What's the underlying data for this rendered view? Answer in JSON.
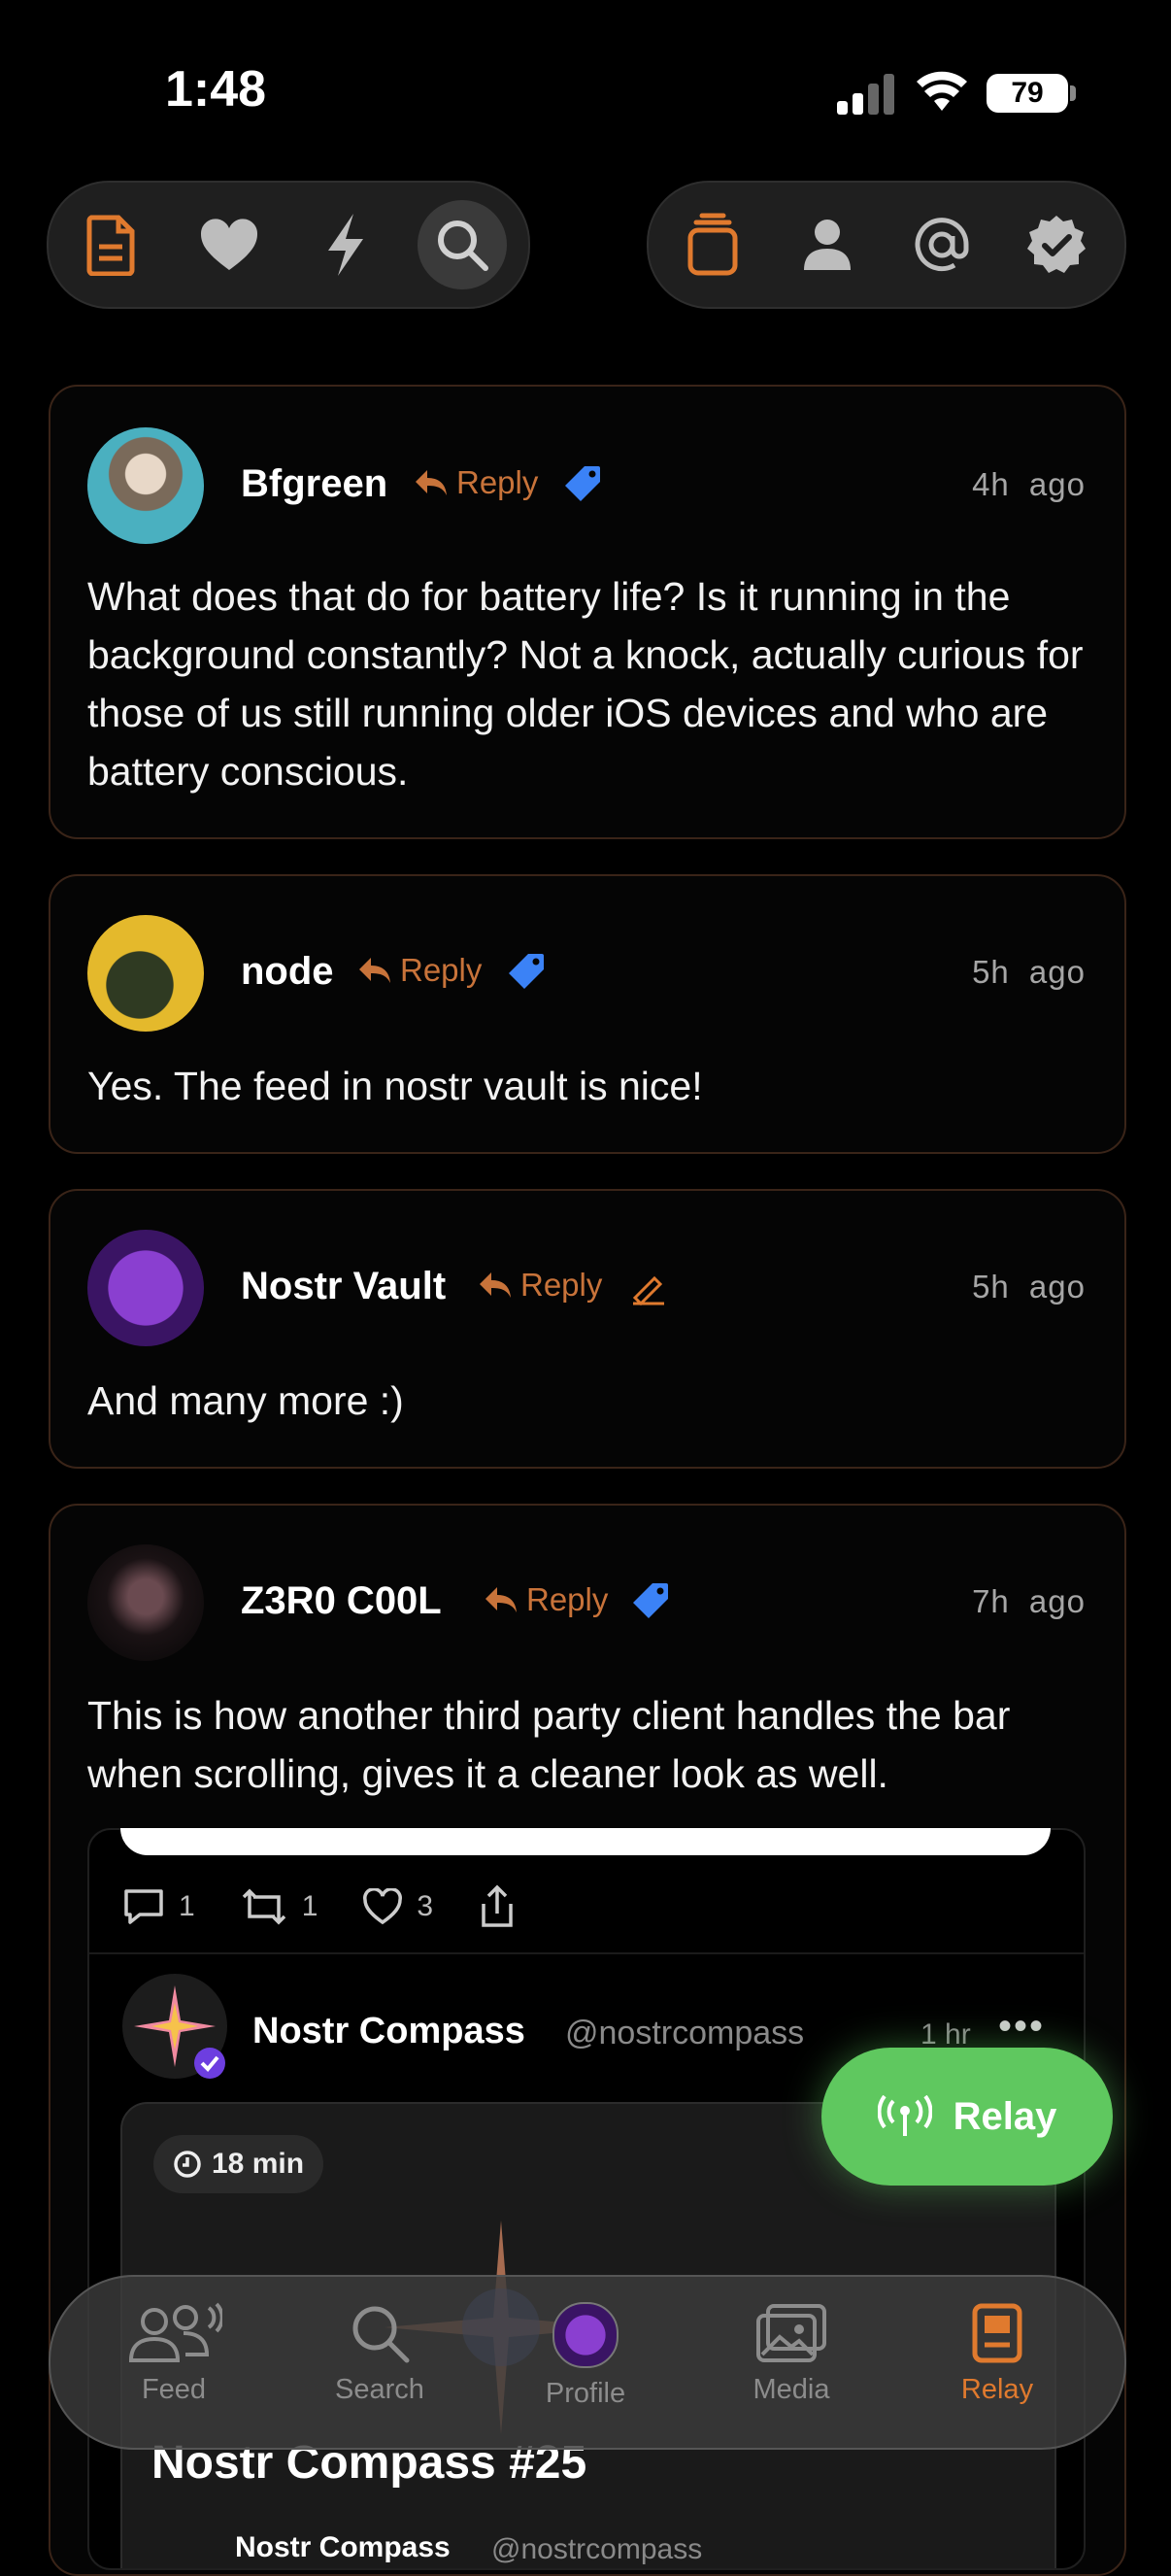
{
  "status_bar": {
    "time": "1:48",
    "battery": "79"
  },
  "top_nav": {
    "left_group": [
      "notes-icon",
      "heart-icon",
      "zap-icon",
      "search-icon"
    ],
    "right_group": [
      "stack-icon",
      "person-icon",
      "at-icon",
      "verified-icon"
    ],
    "accent": "#e07a2e"
  },
  "posts": [
    {
      "username": "Bfgreen",
      "reply_label": "Reply",
      "time": "4h ago",
      "badge": "blue-tag-icon",
      "text": "What does that do for battery life? Is it running in the background constantly? Not a knock, actually curious for those of us still running older iOS devices and who are battery conscious."
    },
    {
      "username": "node",
      "reply_label": "Reply",
      "time": "5h ago",
      "badge": "blue-tag-icon",
      "text": "Yes. The feed in nostr vault is nice!"
    },
    {
      "username": "Nostr Vault",
      "reply_label": "Reply",
      "time": "5h ago",
      "badge": "pen-icon",
      "text": "And many more :)"
    },
    {
      "username": "Z3R0 C00L",
      "reply_label": "Reply",
      "time": "7h ago",
      "badge": "blue-tag-icon",
      "text": "This is how another third party client handles the bar when scrolling, gives it a cleaner look as well."
    }
  ],
  "embed": {
    "stats": {
      "comments": "1",
      "reposts": "1",
      "likes": "3"
    },
    "author_name": "Nostr Compass",
    "author_handle": "@nostrcompass",
    "time": "1 hr",
    "more": "•••",
    "read_time": "18 min",
    "article_title": "Nostr Compass #25",
    "footer_name": "Nostr Compass",
    "footer_handle": "@nostrcompass"
  },
  "relay_button": {
    "label": "Relay",
    "color": "#5fc85f"
  },
  "tab_bar": {
    "tabs": [
      {
        "label": "Feed",
        "icon": "people-icon"
      },
      {
        "label": "Search",
        "icon": "search-icon"
      },
      {
        "label": "Profile",
        "icon": "avatar"
      },
      {
        "label": "Media",
        "icon": "photos-icon"
      },
      {
        "label": "Relay",
        "icon": "relay-doc-icon",
        "active": true
      }
    ]
  }
}
